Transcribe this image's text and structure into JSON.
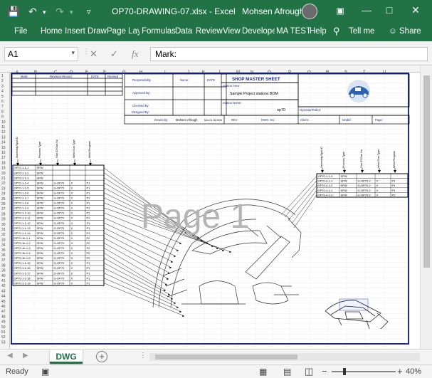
{
  "titlebar": {
    "filename": "OP70-DRAWING-07.xlsx",
    "separator": "-",
    "app": "Excel",
    "user": "Mohsen Afrough"
  },
  "ribbon": {
    "tabs": [
      "File",
      "Home",
      "Insert",
      "Draw",
      "Page Layout",
      "Formulas",
      "Data",
      "Review",
      "View",
      "Developer",
      "MA TEST",
      "Help"
    ],
    "tellme": "Tell me",
    "share": "Share"
  },
  "formula_bar": {
    "namebox": "A1",
    "formula": "Mark:"
  },
  "sheet": {
    "columns": [
      "A",
      "B",
      "C",
      "D",
      "E",
      "F",
      "G",
      "H",
      "I",
      "J",
      "K",
      "L",
      "M",
      "N",
      "O",
      "P",
      "Q",
      "R",
      "S",
      "T",
      "U"
    ],
    "rows": [
      "1",
      "2",
      "3",
      "4",
      "5",
      "6",
      "7",
      "8",
      "9",
      "10",
      "11",
      "12",
      "13",
      "14",
      "15",
      "16",
      "17",
      "18",
      "19",
      "20",
      "21",
      "22",
      "23",
      "24",
      "25",
      "26",
      "27",
      "28",
      "29",
      "30",
      "31",
      "32",
      "33",
      "34",
      "35",
      "36",
      "37",
      "38",
      "39",
      "40",
      "41",
      "42",
      "43",
      "44",
      "45",
      "46",
      "47",
      "48",
      "49",
      "50",
      "51",
      "52",
      "53"
    ],
    "header": {
      "mark": "Mark:",
      "revision": "Revision Record",
      "date": "DATE",
      "revised": "Revised",
      "responsibility": "Responsibility",
      "name": "Name:",
      "date2": "DATE",
      "approved": "Approved By:",
      "checked": "Checked By:",
      "designed": "Designed By:",
      "drawn": "Drawn By:",
      "drawn_name": "Mohsen Afrough",
      "drawn_date": "Mon 01-06-2020",
      "rev": "REV",
      "master_title": "SHOP MASTER SHEET",
      "station_area": "Station Area:",
      "station_area_value": "Sample Project stations BOM",
      "station_name": "Station Name:",
      "station_name_value": "op70",
      "operator": "Operator/Robot:",
      "dwg_no": "DWG. No.:",
      "client": "Client:",
      "model": "Model:",
      "page": "Page:"
    },
    "watermark": "Page 1",
    "left_table_headers": [
      "Assembly/Spot ID",
      "Process Type",
      "Gun ID/Gun No",
      "Weld Gun Type",
      "Weld Program"
    ],
    "left_table_rows": [
      [
        "OP70-1-1-1",
        "SPW",
        "",
        "",
        ""
      ],
      [
        "OP70-1-1-2",
        "SPW",
        "",
        "",
        ""
      ],
      [
        "OP70-1-1-3",
        "SPW",
        "",
        "",
        ""
      ],
      [
        "OP70-1-1-4",
        "SPW",
        "G-OP70",
        "X",
        "P1"
      ],
      [
        "OP70-1-1-5",
        "SPW",
        "G-OP70",
        "X",
        "P1"
      ],
      [
        "OP70-1-1-6",
        "SPW",
        "G-OP70",
        "X",
        "P1"
      ],
      [
        "OP70-1-1-7",
        "SPW",
        "G-OP70",
        "X",
        "P1"
      ],
      [
        "OP70-1-1-8",
        "SPW",
        "G-OP70",
        "X",
        "P1"
      ],
      [
        "OP70-1-1-9",
        "SPW",
        "G-OP70",
        "X",
        "P1"
      ],
      [
        "OP70-1-1-10",
        "SPW",
        "G-OP70",
        "X",
        "P1"
      ],
      [
        "OP70-1-1-11",
        "SPW",
        "G-OP70",
        "X",
        "P1"
      ],
      [
        "OP70-1-1-12",
        "SPW",
        "G-OP70",
        "X",
        "P1"
      ],
      [
        "OP70-1-1-13",
        "SPW",
        "G-OP70",
        "X",
        "P1"
      ],
      [
        "OP70-1-1-14",
        "SPW",
        "G-OP70",
        "X",
        "P1"
      ],
      [
        "OP70-1b-1-1",
        "SPW",
        "G-OP70",
        "X",
        "P2"
      ],
      [
        "OP70-1b-1-2",
        "SPW",
        "G-OP70",
        "X",
        "P2"
      ],
      [
        "OP70-1b-1-3",
        "SPW",
        "G-OP70",
        "X",
        "P2"
      ],
      [
        "OP70-1b-1-4",
        "SPW",
        "G-OP70",
        "X",
        "P2"
      ],
      [
        "OP70-1b-1-5",
        "SPW",
        "G-OP70",
        "X",
        "P2"
      ],
      [
        "OP70-1-1-15",
        "SPW",
        "G-OP70",
        "X",
        "P1"
      ],
      [
        "OP70-1-1-16",
        "SPW",
        "G-OP70",
        "X",
        "P1"
      ],
      [
        "OP70-1-1-17",
        "SPW",
        "G-OP70",
        "X",
        "P1"
      ],
      [
        "OP70-1-1-18",
        "SPW",
        "G-OP70",
        "X",
        "P1"
      ],
      [
        "OP70-1-1-19",
        "SPW",
        "G-OP70",
        "X",
        "P1"
      ]
    ],
    "right_table_headers": [
      "Assembly/Spot ID",
      "Process Type",
      "Gun ID/Gun No",
      "Weld Gun Type",
      "Weld Program"
    ],
    "right_table_rows": [
      [
        "OP70-1-1-4",
        "SPW",
        "",
        "",
        ""
      ],
      [
        "OP70-3-1-1",
        "SPW",
        "G-OP70-2",
        "X",
        "P1"
      ],
      [
        "OP70-4-1-2",
        "SPW",
        "G-OP70-2",
        "X",
        "P1"
      ],
      [
        "OP70-4-1-1",
        "SPW",
        "G-OP70-2",
        "X",
        "P1"
      ],
      [
        "OP70-4-1-3",
        "SPW",
        "G-OP70-2",
        "X",
        "P2"
      ]
    ]
  },
  "sheet_tabs": {
    "active": "DWG"
  },
  "status": {
    "ready": "Ready",
    "zoom": "40%"
  },
  "colors": {
    "excel_green": "#217346",
    "border_blue": "#1f2d8f",
    "watermark": "#b4b4b4"
  }
}
